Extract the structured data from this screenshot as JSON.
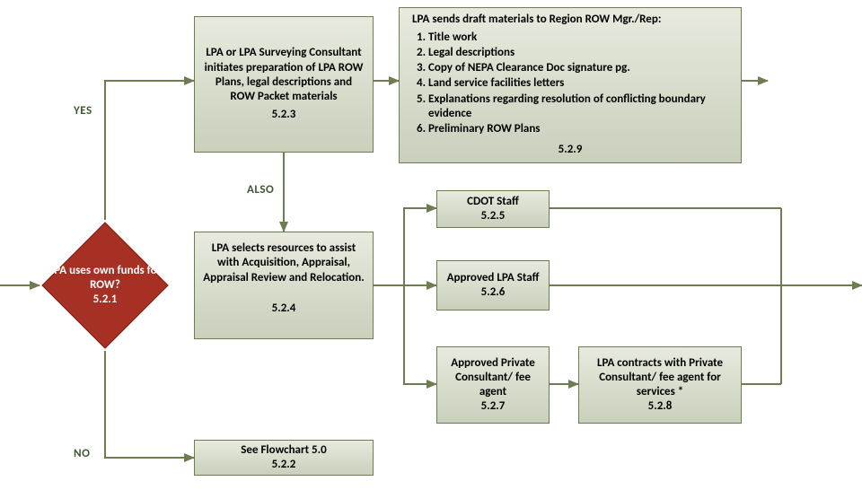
{
  "decision": {
    "text": "LPA uses own funds for ROW?",
    "ref": "5.2.1"
  },
  "labels": {
    "yes": "YES",
    "also": "ALSO",
    "no": "NO"
  },
  "box_523": {
    "text": "LPA or LPA Surveying Consultant initiates preparation of LPA ROW Plans, legal descriptions and ROW Packet materials",
    "ref": "5.2.3"
  },
  "box_529": {
    "title": "LPA sends draft materials to Region ROW Mgr./Rep:",
    "items": [
      "Title work",
      "Legal descriptions",
      "Copy of NEPA Clearance Doc signature pg.",
      "Land service facilities letters",
      "Explanations regarding resolution of conflicting boundary evidence",
      "Preliminary ROW Plans"
    ],
    "ref": "5.2.9"
  },
  "box_524": {
    "text": "LPA selects resources to assist with Acquisition, Appraisal, Appraisal Review and Relocation.",
    "ref": "5.2.4"
  },
  "box_522": {
    "text": "See Flowchart 5.0",
    "ref": "5.2.2"
  },
  "box_525": {
    "text": "CDOT Staff",
    "ref": "5.2.5"
  },
  "box_526": {
    "text": "Approved LPA Staff",
    "ref": "5.2.6"
  },
  "box_527": {
    "text": "Approved Private Consultant/ fee agent",
    "ref": "5.2.7"
  },
  "box_528": {
    "text": "LPA contracts with Private Consultant/ fee agent for services *",
    "ref": "5.2.8"
  }
}
